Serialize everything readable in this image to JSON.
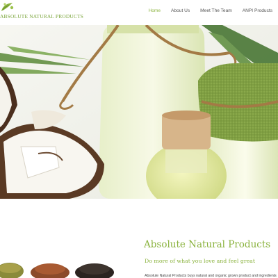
{
  "brand": {
    "logo_text": "ABSOLUTE NATURAL PRODUCTS",
    "accent_color": "#8bb33f"
  },
  "nav": {
    "items": [
      {
        "label": "Home",
        "active": true
      },
      {
        "label": "About Us",
        "active": false
      },
      {
        "label": "Meet The Team",
        "active": false
      },
      {
        "label": "ANPI Products",
        "active": false
      }
    ]
  },
  "hero": {
    "image": "coconut oil bottles with halved coconuts and burlap cap"
  },
  "content": {
    "title": "Absolute Natural Products",
    "subtitle": "Do more of what you love and feel great",
    "body": "Absolute Natural Products buys natural and organic grown product and ingredients"
  },
  "spices": {
    "image": "bowls of dried spices and seeds"
  }
}
